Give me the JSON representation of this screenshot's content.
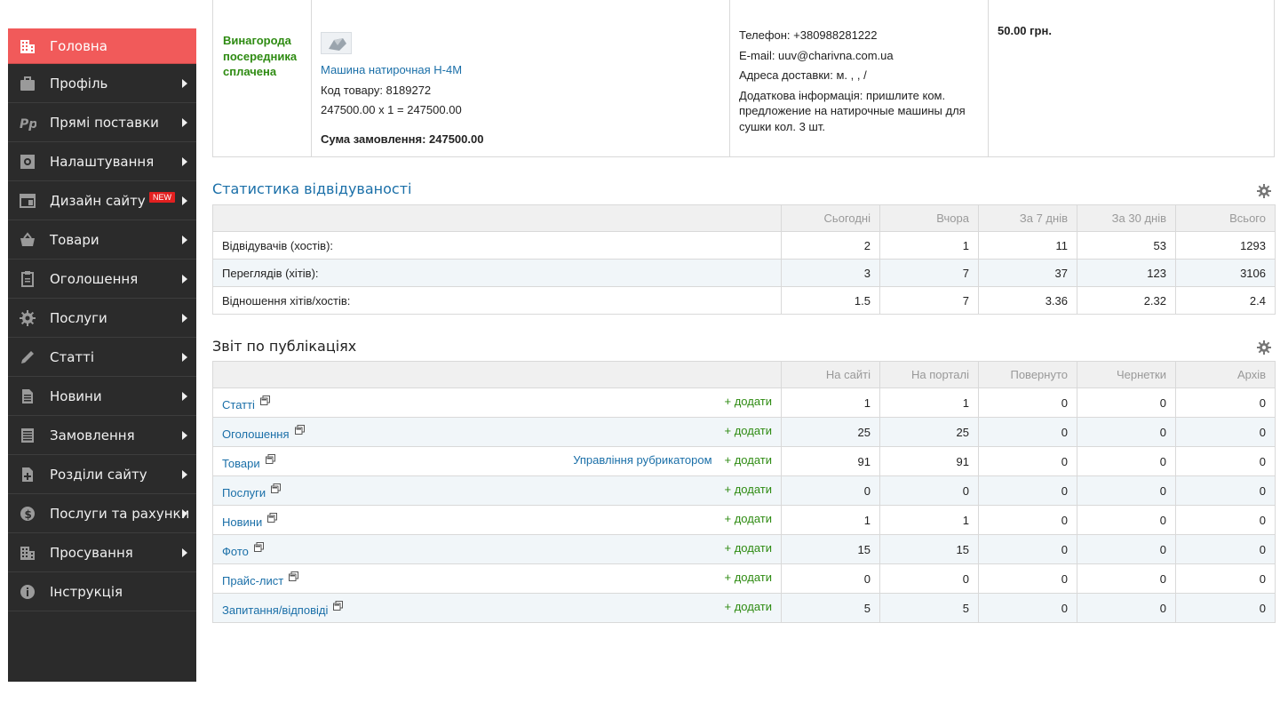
{
  "sidebar": {
    "items": [
      {
        "label": "Головна",
        "icon": "building-icon",
        "active": true,
        "arrow": false
      },
      {
        "label": "Профіль",
        "icon": "briefcase-icon",
        "active": false,
        "arrow": true
      },
      {
        "label": "Прямі поставки",
        "icon": "pp-icon",
        "active": false,
        "arrow": true
      },
      {
        "label": "Налаштування",
        "icon": "settings-box-icon",
        "active": false,
        "arrow": true
      },
      {
        "label": "Дизайн сайту",
        "icon": "layout-icon",
        "active": false,
        "arrow": true,
        "badge": "NEW"
      },
      {
        "label": "Товари",
        "icon": "basket-icon",
        "active": false,
        "arrow": true
      },
      {
        "label": "Оголошення",
        "icon": "clipboard-icon",
        "active": false,
        "arrow": true
      },
      {
        "label": "Послуги",
        "icon": "gear-icon",
        "active": false,
        "arrow": true
      },
      {
        "label": "Статті",
        "icon": "pencil-icon",
        "active": false,
        "arrow": true
      },
      {
        "label": "Новини",
        "icon": "document-icon",
        "active": false,
        "arrow": true
      },
      {
        "label": "Замовлення",
        "icon": "list-icon",
        "active": false,
        "arrow": true
      },
      {
        "label": "Розділи сайту",
        "icon": "file-plus-icon",
        "active": false,
        "arrow": true
      },
      {
        "label": "Послуги та рахунки",
        "icon": "dollar-icon",
        "active": false,
        "arrow": true
      },
      {
        "label": "Просування",
        "icon": "building-icon",
        "active": false,
        "arrow": true
      },
      {
        "label": "Інструкція",
        "icon": "info-icon",
        "active": false,
        "arrow": false
      }
    ]
  },
  "order": {
    "status": "Винагорода посередника сплачена",
    "product_name": "Машина натирочная Н-4М",
    "product_code": "Код товару: 8189272",
    "calc": "247500.00 x 1 = 247500.00",
    "total": "Сума замовлення: 247500.00",
    "phone": "Телефон: +380988281222",
    "email": "E-mail: uuv@charivna.com.ua",
    "address": "Адреса доставки: м. , , /",
    "extra": "Додаткова інформація: пришлите ком. предложение на натирочные машины для сушки кол. 3 шт.",
    "fee": "50.00 грн."
  },
  "stats": {
    "title": "Статистика відвідуваності",
    "headers": [
      "",
      "Сьогодні",
      "Вчора",
      "За 7 днів",
      "За 30 днів",
      "Всього"
    ],
    "rows": [
      [
        "Відвідувачів (хостів):",
        "2",
        "1",
        "11",
        "53",
        "1293"
      ],
      [
        "Переглядів (хітів):",
        "3",
        "7",
        "37",
        "123",
        "3106"
      ],
      [
        "Відношення хітів/хостів:",
        "1.5",
        "7",
        "3.36",
        "2.32",
        "2.4"
      ]
    ]
  },
  "publications": {
    "title": "Звіт по публікаціях",
    "headers": [
      "",
      "На сайті",
      "На порталі",
      "Повернуто",
      "Чернетки",
      "Архів"
    ],
    "add_label": "+ додати",
    "rubricator_label": "Управління рубрикатором",
    "rows": [
      {
        "name": "Статті",
        "values": [
          "1",
          "1",
          "0",
          "0",
          "0"
        ]
      },
      {
        "name": "Оголошення",
        "values": [
          "25",
          "25",
          "0",
          "0",
          "0"
        ]
      },
      {
        "name": "Товари",
        "values": [
          "91",
          "91",
          "0",
          "0",
          "0"
        ],
        "rubricator": true
      },
      {
        "name": "Послуги",
        "values": [
          "0",
          "0",
          "0",
          "0",
          "0"
        ]
      },
      {
        "name": "Новини",
        "values": [
          "1",
          "1",
          "0",
          "0",
          "0"
        ]
      },
      {
        "name": "Фото",
        "values": [
          "15",
          "15",
          "0",
          "0",
          "0"
        ]
      },
      {
        "name": "Прайс-лист",
        "values": [
          "0",
          "0",
          "0",
          "0",
          "0"
        ]
      },
      {
        "name": "Запитання/відповіді",
        "values": [
          "5",
          "5",
          "0",
          "0",
          "0"
        ]
      }
    ]
  },
  "colors": {
    "sidebar_bg": "#2b2b2b",
    "active_item": "#f15a5a",
    "link": "#1a6fa8",
    "add_link": "#2e8b12"
  }
}
